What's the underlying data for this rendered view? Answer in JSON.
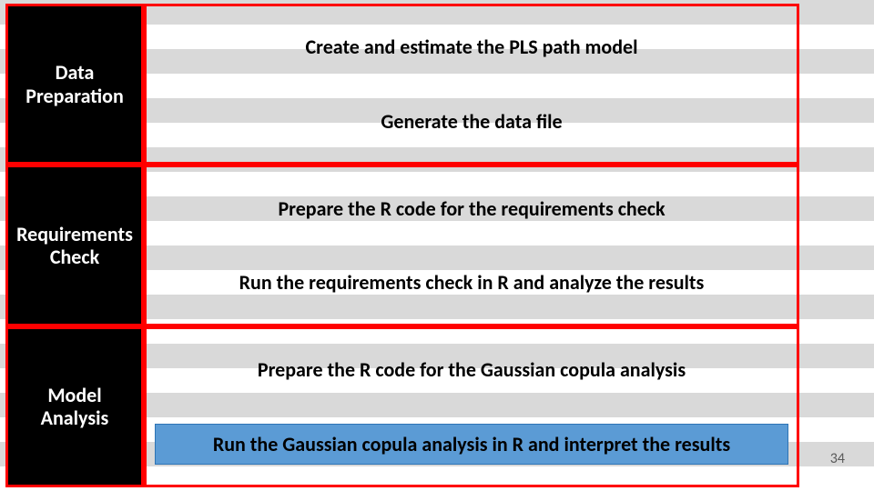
{
  "sections": [
    {
      "label": "Data\nPreparation",
      "steps": [
        {
          "text": "Create and estimate the PLS path model",
          "highlight": false
        },
        {
          "text": "Generate the data file",
          "highlight": false
        }
      ]
    },
    {
      "label": "Requirements\nCheck",
      "steps": [
        {
          "text": "Prepare the R code for the requirements check",
          "highlight": false
        },
        {
          "text": "Run the requirements check in R and analyze the results",
          "highlight": false
        }
      ]
    },
    {
      "label": "Model\nAnalysis",
      "steps": [
        {
          "text": "Prepare the R code for the Gaussian copula analysis",
          "highlight": false
        },
        {
          "text": "Run the Gaussian copula analysis in R and interpret the results",
          "highlight": true
        }
      ]
    }
  ],
  "page_number": "34"
}
